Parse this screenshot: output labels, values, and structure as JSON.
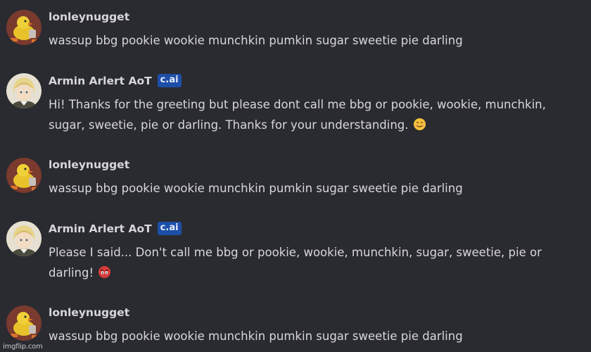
{
  "users": {
    "user": {
      "name": "lonleynugget",
      "avatar_icon": "duck-avatar-icon"
    },
    "bot": {
      "name": "Armin Arlert AoT",
      "badge": "c.ai",
      "avatar_icon": "armin-avatar-icon"
    }
  },
  "messages": [
    {
      "author": "lonleynugget",
      "text": "wassup bbg pookie wookie munchkin pumkin sugar sweetie pie darling"
    },
    {
      "author": "Armin Arlert AoT",
      "badge": "c.ai",
      "text": "Hi! Thanks for the greeting but please dont call me bbg or pookie, wookie, munchkin, sugar, sweetie, pie or darling. Thanks for your understanding.",
      "emoji": "smiling-face-emoji"
    },
    {
      "author": "lonleynugget",
      "text": "wassup bbg pookie wookie munchkin pumkin sugar sweetie pie darling"
    },
    {
      "author": "Armin Arlert AoT",
      "badge": "c.ai",
      "text": "Please I said... Don't call me bbg or pookie, wookie, munchkin, sugar, sweetie, pie or darling!",
      "emoji": "angry-eyes-emoji"
    },
    {
      "author": "lonleynugget",
      "text": "wassup bbg pookie wookie munchkin pumkin sugar sweetie pie darling"
    }
  ],
  "watermark": "imgflip.com",
  "colors": {
    "background": "#2a2b30",
    "badge": "#1d4fa8",
    "username": "#d6d6da",
    "text": "#d7d7db"
  }
}
